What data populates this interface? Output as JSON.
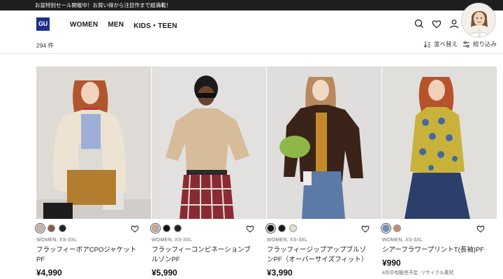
{
  "announcement": "お盆特別セール開催中！お買い得から注目作まで超満載！",
  "header": {
    "logo": "GU",
    "nav": [
      "WOMEN",
      "MEN",
      "KIDS・TEEN"
    ]
  },
  "subbar": {
    "count": "294 件",
    "sort_label": "並べ替え",
    "filter_label": "絞り込み"
  },
  "products": [
    {
      "meta": "WOMEN, XS-3XL",
      "name": "フラッフィーボアCPOジャケットPF",
      "price": "¥4,990",
      "swatches": [
        "#c9b7a4",
        "#8a5a3e",
        "#222222"
      ],
      "note": ""
    },
    {
      "meta": "WOMEN, XS-3XL",
      "name": "フラッフィーコンビネーションブルゾンPF",
      "price": "¥5,990",
      "swatches": [
        "#c9a78a",
        "#111111",
        "#222222"
      ],
      "note": ""
    },
    {
      "meta": "WOMEN, XS-3XL",
      "name": "フラッフィージップアップブルゾンPF（オーバーサイズフィット）",
      "price": "¥3,990",
      "swatches": [
        "#111111",
        "#1a1a1a",
        "#e8dccb"
      ],
      "note": ""
    },
    {
      "meta": "WOMEN, XS-3XL",
      "name": "シアーフラワープリントT(長袖)PF",
      "price": "¥990",
      "swatches": [
        "#6b8fbf",
        "#c98a6b"
      ],
      "note": "8月中旬販売予定, リサイクル素材"
    }
  ],
  "colors": {
    "topbar_bg": "#1f1f1f",
    "logo_bg": "#1c2f8c"
  }
}
